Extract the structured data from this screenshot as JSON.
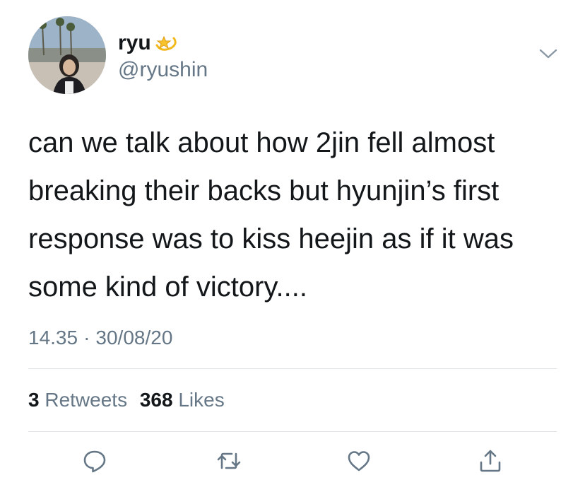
{
  "tweet": {
    "author_name": "ryu",
    "author_handle": "@ryushin",
    "text": "can we talk about how 2jin fell almost\nbreaking their backs but hyunjin’s first\nresponse was to kiss heejin as if it was\nsome kind of victory....",
    "time": "14.35",
    "separator": "·",
    "date": "30/08/20",
    "retweets_count": "3",
    "retweets_label": "Retweets",
    "likes_count": "368",
    "likes_label": "Likes"
  },
  "icons": {
    "name_emoji": "dizzy-star-icon",
    "menu": "chevron-down-icon",
    "reply": "reply-icon",
    "retweet": "retweet-icon",
    "like": "heart-icon",
    "share": "share-icon"
  },
  "colors": {
    "text": "#14171a",
    "secondary": "#657786",
    "divider": "#dfe3e6"
  }
}
